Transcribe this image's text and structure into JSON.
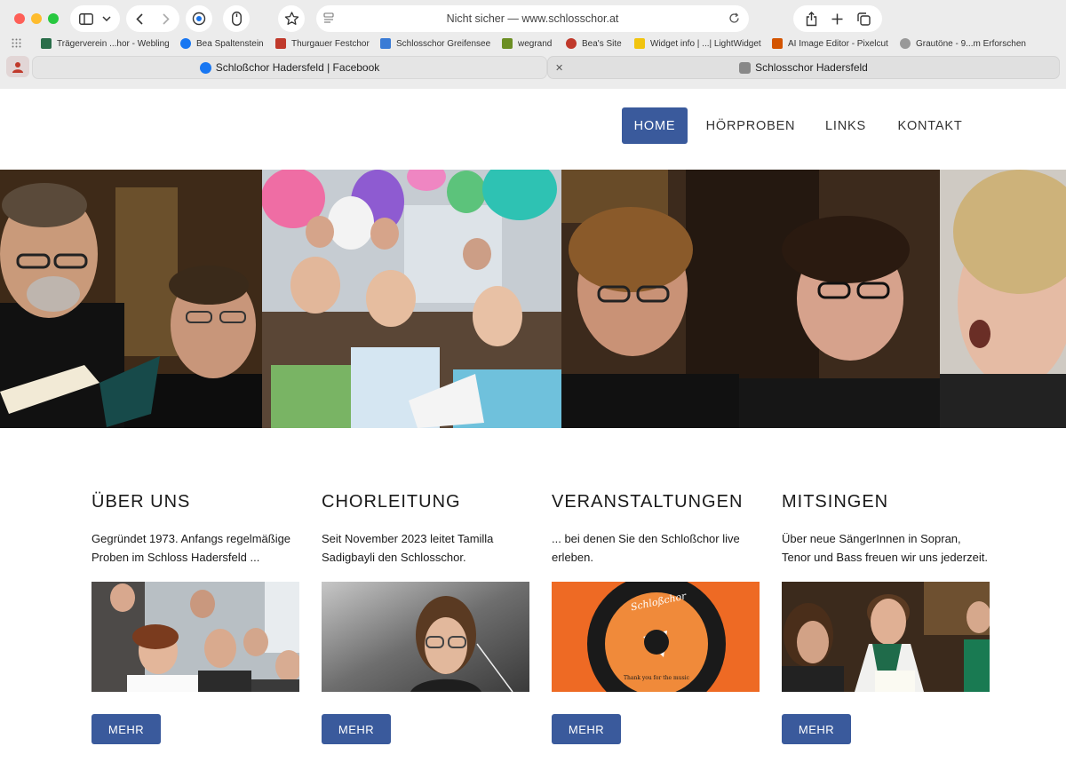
{
  "browser": {
    "address": "Nicht sicher — www.schlosschor.at",
    "bookmarks": [
      {
        "label": "Trägerverein ...hor - Webling",
        "color": "#2a6e4a"
      },
      {
        "label": "Bea Spaltenstein",
        "color": "#1877f2"
      },
      {
        "label": "Thurgauer Festchor",
        "color": "#c0392b"
      },
      {
        "label": "Schlosschor Greifensee",
        "color": "#3a7bd5"
      },
      {
        "label": "wegrand",
        "color": "#6b8e23"
      },
      {
        "label": "Bea's Site",
        "color": "#c0392b"
      },
      {
        "label": "Widget info | ...| LightWidget",
        "color": "#f1c40f"
      },
      {
        "label": "AI Image Editor - Pixelcut",
        "color": "#d35400"
      },
      {
        "label": "Grautöne - 9...m Erforschen",
        "color": "#999999"
      }
    ],
    "tabs": [
      {
        "label": "Schloßchor Hadersfeld | Facebook",
        "favicon": "facebook-icon",
        "color": "#1877f2"
      },
      {
        "label": "Schlosschor Hadersfeld",
        "favicon": "s-favicon-icon",
        "color": "#888888"
      }
    ]
  },
  "site": {
    "nav": [
      {
        "label": "HOME"
      },
      {
        "label": "HÖRPROBEN"
      },
      {
        "label": "LINKS"
      },
      {
        "label": "KONTAKT"
      }
    ],
    "accent": "#3a5a9c",
    "sections": [
      {
        "title": "ÜBER UNS",
        "text": "Gegründet 1973. Anfangs regelmäßige Proben im Schloss Hadersfeld ...",
        "button": "MEHR"
      },
      {
        "title": "CHORLEITUNG",
        "text": "Seit November 2023 leitet Tamilla Sadigbayli den Schlosschor.",
        "button": "MEHR"
      },
      {
        "title": "VERANSTALTUNGEN",
        "text": "... bei denen Sie den Schloßchor live erleben.",
        "button": "MEHR"
      },
      {
        "title": "MITSINGEN",
        "text": "Über neue SängerInnen in Sopran, Tenor und Bass freuen wir uns jederzeit.",
        "button": "MEHR"
      }
    ],
    "record_label": {
      "brand": "Schloßchor",
      "title": "Thank you for the music"
    }
  }
}
